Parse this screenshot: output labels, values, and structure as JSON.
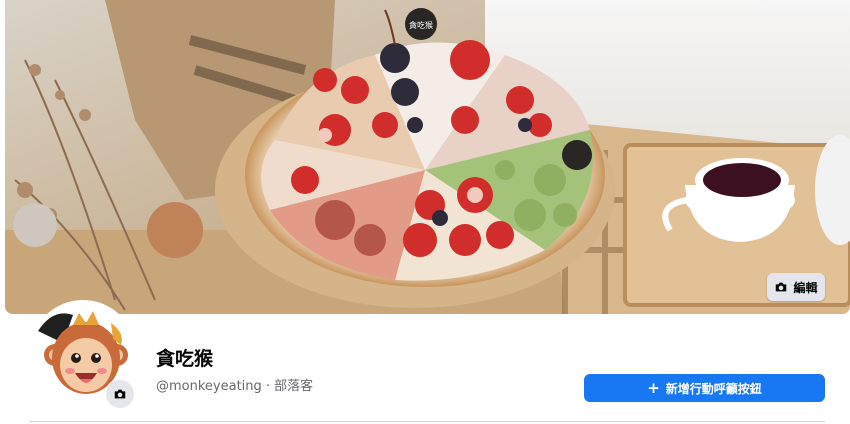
{
  "cover": {
    "edit_label": "編輯",
    "tag_text": "貪吃猴"
  },
  "profile": {
    "name": "貪吃猴",
    "meta": "@monkeyeating · 部落客"
  },
  "actions": {
    "cta_label": "新增行動呼籲按鈕",
    "cta_icon": "plus-icon"
  },
  "colors": {
    "primary": "#1877f2",
    "button_gray": "#e4e6eb",
    "text_secondary": "#65676b"
  }
}
